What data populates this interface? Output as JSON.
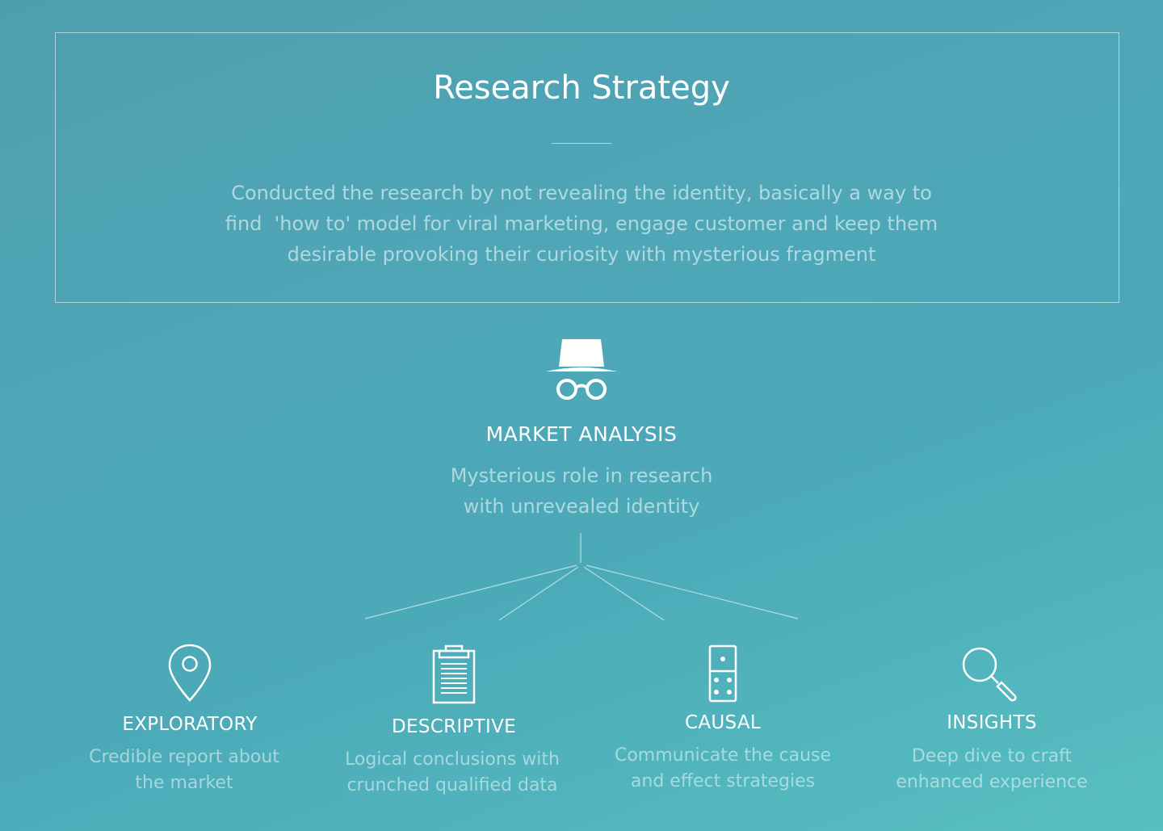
{
  "header": {
    "title": "Research Strategy",
    "intro_line1": "Conducted the research by not revealing the identity, basically a way to",
    "intro_line2": "find  'how to' model for viral marketing, engage customer and keep them",
    "intro_line3": "desirable provoking their curiosity with mysterious fragment"
  },
  "center": {
    "icon": "spy-incognito-icon",
    "title": "MARKET ANALYSIS",
    "desc_line1": "Mysterious role in research",
    "desc_line2": "with unrevealed identity"
  },
  "branches": [
    {
      "icon": "location-pin-icon",
      "title": "EXPLORATORY",
      "desc_line1": "Credible report about",
      "desc_line2": "the market"
    },
    {
      "icon": "clipboard-icon",
      "title": "DESCRIPTIVE",
      "desc_line1": "Logical conclusions with",
      "desc_line2": "crunched qualified data"
    },
    {
      "icon": "domino-icon",
      "title": "CAUSAL",
      "desc_line1": "Communicate the cause",
      "desc_line2": "and effect strategies"
    },
    {
      "icon": "magnifier-icon",
      "title": "INSIGHTS",
      "desc_line1": "Deep dive to craft",
      "desc_line2": "enhanced experience"
    }
  ],
  "colors": {
    "line": "#ffffff",
    "text": "#ffffff"
  }
}
